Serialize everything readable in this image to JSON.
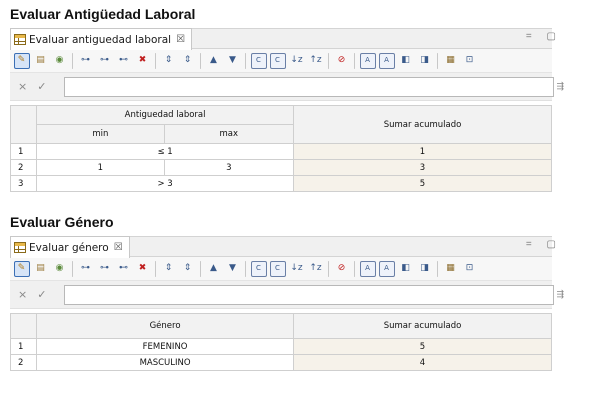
{
  "section1": {
    "title": "Evaluar Antigüedad Laboral",
    "tab_label": "Evaluar antiguedad laboral",
    "tab_close": "☒",
    "header": {
      "group": "Antiguedad laboral",
      "min": "min",
      "max": "max",
      "output": "Sumar  acumulado"
    },
    "rows": [
      {
        "index": "1",
        "cond": "≤ 1",
        "output": "1"
      },
      {
        "index": "2",
        "min": "1",
        "max": "3",
        "output": "3"
      },
      {
        "index": "3",
        "cond": "> 3",
        "output": "5"
      }
    ]
  },
  "section2": {
    "title": "Evaluar Género",
    "tab_label": "Evaluar género",
    "tab_close": "☒",
    "header": {
      "input": "Género",
      "output": "Sumar  acumulado"
    },
    "rows": [
      {
        "index": "1",
        "value": "FEMENINO",
        "output": "5"
      },
      {
        "index": "2",
        "value": "MASCULINO",
        "output": "4"
      }
    ]
  },
  "formula": {
    "cancel": "×",
    "accept": "✓"
  },
  "window_controls": "= ▢",
  "toolbar_glyphs": [
    "✎",
    "▤",
    "◉",
    "⊶",
    "⊶",
    "⊷",
    "✖",
    "⇕",
    "⇕",
    "▲",
    "▼",
    "ⓒ",
    "ⓒ",
    "↓z",
    "↑z",
    "⊘",
    "A",
    "A",
    "◧",
    "◨",
    "▦",
    "⊡"
  ]
}
